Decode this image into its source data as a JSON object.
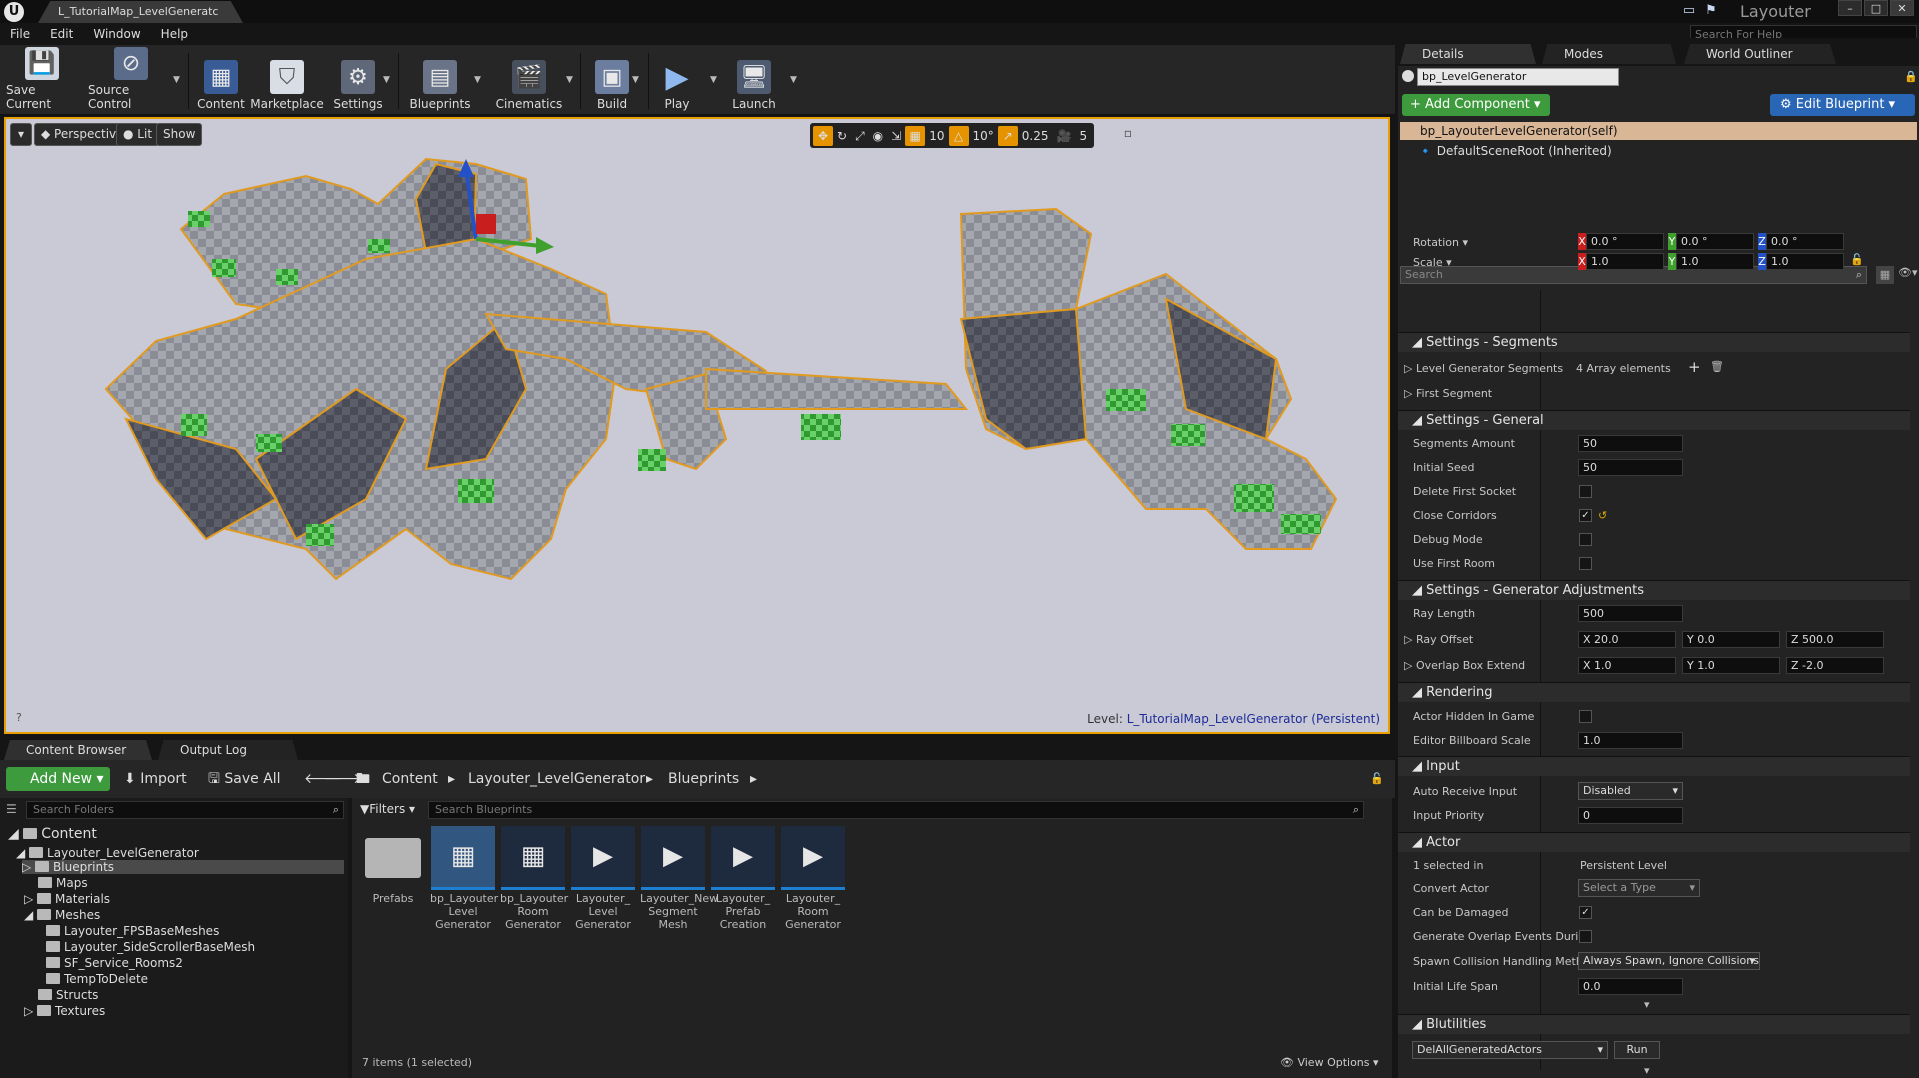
{
  "window": {
    "doc_tab": "L_TutorialMap_LevelGeneratc",
    "app_title": "Layouter",
    "help_search_placeholder": "Search For Help"
  },
  "menu": [
    "File",
    "Edit",
    "Window",
    "Help"
  ],
  "toolbar": [
    {
      "label": "Save Current",
      "icon": "save-icon"
    },
    {
      "label": "Source Control",
      "icon": "source-control-icon"
    },
    {
      "label": "Content",
      "icon": "content-icon"
    },
    {
      "label": "Marketplace",
      "icon": "marketplace-icon"
    },
    {
      "label": "Settings",
      "icon": "settings-icon"
    },
    {
      "label": "Blueprints",
      "icon": "blueprints-icon"
    },
    {
      "label": "Cinematics",
      "icon": "cinematics-icon"
    },
    {
      "label": "Build",
      "icon": "build-icon"
    },
    {
      "label": "Play",
      "icon": "play-icon"
    },
    {
      "label": "Launch",
      "icon": "launch-icon"
    }
  ],
  "viewport": {
    "perspective": "Perspective",
    "lit": "Lit",
    "show": "Show",
    "grid_snap": "10",
    "rotation_snap": "10°",
    "scale_snap": "0.25",
    "camera_speed": "5",
    "level_prefix": "Level:",
    "level_name": "L_TutorialMap_LevelGenerator (Persistent)",
    "help_glyph": "?"
  },
  "content_browser": {
    "tabs": [
      "Content Browser",
      "Output Log"
    ],
    "add_new": "Add New",
    "import": "Import",
    "save_all": "Save All",
    "breadcrumbs": [
      "Content",
      "Layouter_LevelGenerator",
      "Blueprints"
    ],
    "folder_search_placeholder": "Search Folders",
    "filters": "Filters",
    "asset_search_placeholder": "Search Blueprints",
    "tree": [
      {
        "label": "Content",
        "depth": 0
      },
      {
        "label": "Layouter_LevelGenerator",
        "depth": 1
      },
      {
        "label": "Blueprints",
        "depth": 2,
        "selected": true
      },
      {
        "label": "Maps",
        "depth": 2
      },
      {
        "label": "Materials",
        "depth": 2
      },
      {
        "label": "Meshes",
        "depth": 2
      },
      {
        "label": "Layouter_FPSBaseMeshes",
        "depth": 3
      },
      {
        "label": "Layouter_SideScrollerBaseMesh",
        "depth": 3
      },
      {
        "label": "SF_Service_Rooms2",
        "depth": 3
      },
      {
        "label": "TempToDelete",
        "depth": 3
      },
      {
        "label": "Structs",
        "depth": 2
      },
      {
        "label": "Textures",
        "depth": 2
      }
    ],
    "assets": [
      {
        "label": "Prefabs",
        "kind": "folder"
      },
      {
        "label": "bp_Layouter Level Generator",
        "kind": "blueprint",
        "selected": true
      },
      {
        "label": "bp_Layouter Room Generator",
        "kind": "blueprint"
      },
      {
        "label": "Layouter_ Level Generator",
        "kind": "widget"
      },
      {
        "label": "Layouter_New Segment Mesh",
        "kind": "widget"
      },
      {
        "label": "Layouter_ Prefab Creation",
        "kind": "widget"
      },
      {
        "label": "Layouter_ Room Generator",
        "kind": "widget"
      }
    ],
    "status": "7 items (1 selected)",
    "view_options": "View Options"
  },
  "details": {
    "tabs": [
      "Details",
      "Modes",
      "World Outliner"
    ],
    "actor_name": "bp_LevelGenerator",
    "add_component": "Add Component",
    "edit_blueprint": "Edit Blueprint",
    "self_row": "bp_LayouterLevelGenerator(self)",
    "scene_root": "DefaultSceneRoot (Inherited)",
    "search_placeholder": "Search",
    "rotation_label": "Rotation",
    "rotation": [
      "0.0 °",
      "0.0 °",
      "0.0 °"
    ],
    "scale_label": "Scale",
    "scale": [
      "1.0",
      "1.0",
      "1.0"
    ],
    "sec_segments": "Settings - Segments",
    "level_gen_segments_label": "Level Generator Segments",
    "level_gen_segments_value": "4 Array elements",
    "first_segment_label": "First Segment",
    "sec_general": "Settings - General",
    "segments_amount_label": "Segments Amount",
    "segments_amount": "50",
    "initial_seed_label": "Initial Seed",
    "initial_seed": "50",
    "delete_first_socket_label": "Delete First Socket",
    "close_corridors_label": "Close Corridors",
    "debug_mode_label": "Debug Mode",
    "use_first_room_label": "Use First Room",
    "sec_adjust": "Settings - Generator Adjustments",
    "ray_length_label": "Ray Length",
    "ray_length": "500",
    "ray_offset_label": "Ray Offset",
    "ray_offset": [
      "20.0",
      "0.0",
      "500.0"
    ],
    "overlap_box_label": "Overlap Box Extend",
    "overlap_box": [
      "1.0",
      "1.0",
      "-2.0"
    ],
    "sec_rendering": "Rendering",
    "actor_hidden_label": "Actor Hidden In Game",
    "billboard_scale_label": "Editor Billboard Scale",
    "billboard_scale": "1.0",
    "sec_input": "Input",
    "auto_receive_label": "Auto Receive Input",
    "auto_receive": "Disabled",
    "input_priority_label": "Input Priority",
    "input_priority": "0",
    "sec_actor": "Actor",
    "selected_in_label": "1 selected in",
    "selected_in": "Persistent Level",
    "convert_actor_label": "Convert Actor",
    "convert_actor": "Select a Type",
    "can_be_damaged_label": "Can be Damaged",
    "overlap_events_label": "Generate Overlap Events During",
    "spawn_collision_label": "Spawn Collision Handling Metho",
    "spawn_collision": "Always Spawn, Ignore Collisions",
    "initial_life_label": "Initial Life Span",
    "initial_life": "0.0",
    "sec_blutilities": "Blutilities",
    "blutility_function": "DelAllGeneratedActors",
    "run": "Run",
    "axis_x": "X",
    "axis_y": "Y",
    "axis_z": "Z"
  },
  "colors": {
    "accent_green": "#3d9b3d",
    "accent_blue": "#2966b5",
    "selection_orange": "#e8a000",
    "axis_x": "#c81e1e",
    "axis_y": "#3fa02e",
    "axis_z": "#2450c8"
  }
}
